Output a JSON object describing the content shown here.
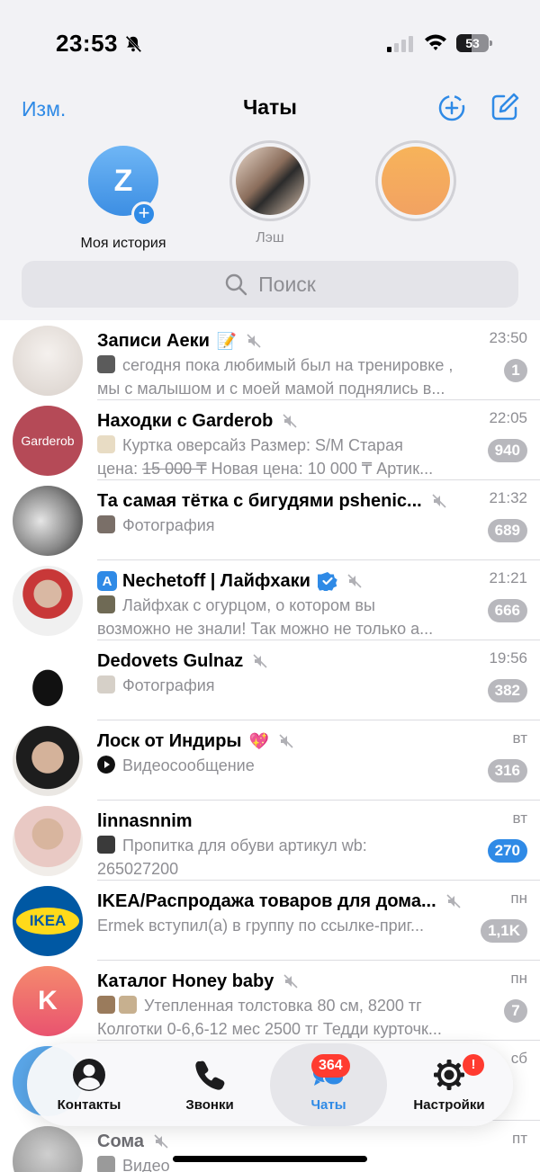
{
  "status_bar": {
    "time": "23:53",
    "battery": "53"
  },
  "nav": {
    "edit_label": "Изм.",
    "title": "Чаты"
  },
  "stories": [
    {
      "label": "Моя история",
      "avatar_letter": "Z"
    },
    {
      "label": "Лэш"
    },
    {
      "label": ""
    }
  ],
  "search": {
    "placeholder": "Поиск"
  },
  "chats": [
    {
      "name": "Записи Аеки",
      "time": "23:50",
      "line1": "сегодня пока любимый был на тренировке ,",
      "line2": "мы с малышом и с моей мамой поднялись в...",
      "badge": "1",
      "muted": true
    },
    {
      "name": "Находки с Garderob",
      "avatar_text": "Garderob",
      "time": "22:05",
      "line1": "Куртка оверсайз Размер: S/M Старая",
      "line2_prefix": "цена: ",
      "line2_strike": "15 000 ₸",
      "line2_suffix": " Новая цена: 10 000 ₸ Артик...",
      "badge": "940",
      "muted": true
    },
    {
      "name": "Та самая тётка с бигудями pshenic...",
      "time": "21:32",
      "line1": "Фотография",
      "badge": "689",
      "muted": true
    },
    {
      "name": "Nechetoff | Лайфхаки",
      "time": "21:21",
      "line1": "Лайфхак с огурцом, о котором вы",
      "line2": "возможно не знали! Так можно не только а...",
      "badge": "666",
      "muted": true,
      "verified": true
    },
    {
      "name": "Dedovets Gulnaz",
      "time": "19:56",
      "line1": "Фотография",
      "badge": "382",
      "muted": true
    },
    {
      "name": "Лоск от Индиры",
      "time": "вт",
      "line1": "Видеосообщение",
      "badge": "316",
      "muted": true
    },
    {
      "name": "linnasnnim",
      "time": "вт",
      "line1": "Пропитка для обуви артикул wb:",
      "line2": "265027200",
      "badge": "270",
      "muted": false
    },
    {
      "name": "IKEA/Распродажа товаров для дома...",
      "avatar_text": "IKEA",
      "time": "пн",
      "line1": "Ermek вступил(а) в группу по ссылке-приг...",
      "badge": "1,1K",
      "muted": true
    },
    {
      "name": "Каталог Honey baby",
      "avatar_letter": "K",
      "time": "пн",
      "line1": "Утепленная толстовка 80 см, 8200 тг",
      "line2": "Колготки 0-6,6-12 мес 2500 тг Тедди курточк...",
      "badge": "7",
      "muted": true
    },
    {
      "name": "",
      "time": "сб",
      "line1": "",
      "badge": ""
    },
    {
      "name": "Сома",
      "time": "пт",
      "line1": "Видео",
      "badge": ""
    }
  ],
  "tabbar": {
    "items": [
      {
        "label": "Контакты"
      },
      {
        "label": "Звонки"
      },
      {
        "label": "Чаты",
        "badge": "364"
      },
      {
        "label": "Настройки",
        "badge": "!"
      }
    ]
  },
  "colors": {
    "accent": "#2f8ae6",
    "badge_muted": "#b8b8bd",
    "badge_red": "#ff3b30"
  }
}
